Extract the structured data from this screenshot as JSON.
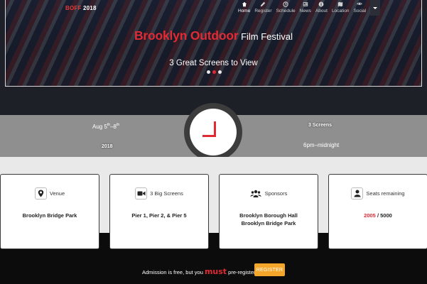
{
  "brand": {
    "part1": "BOFF",
    "part2": " 2018"
  },
  "nav": {
    "items": [
      {
        "label": "Home",
        "icon": "home-icon",
        "active": true
      },
      {
        "label": "Register",
        "icon": "pen-icon",
        "active": false
      },
      {
        "label": "Schedule",
        "icon": "clock-icon",
        "active": false
      },
      {
        "label": "News",
        "icon": "news-icon",
        "active": false
      },
      {
        "label": "About",
        "icon": "info-icon",
        "active": false
      },
      {
        "label": "Location",
        "icon": "map-icon",
        "active": false
      },
      {
        "label": "Social",
        "icon": "social-icon",
        "active": false
      }
    ]
  },
  "hero": {
    "title_red": "Brooklyn Outdoor",
    "title_white": " Film Festival",
    "subtitle": "3 Great Screens to View",
    "slides": 3,
    "active_slide": 1
  },
  "stats": {
    "dates_start": "Aug 5",
    "dates_start_sup": "th",
    "dates_mid": "–8",
    "dates_end_sup": "th",
    "year": "2018",
    "screens": "3 Screens",
    "time": "6pm–midnight"
  },
  "cards": [
    {
      "label": "Venue",
      "icon": "map-pin-icon",
      "lines": [
        "Brooklyn Bridge Park"
      ]
    },
    {
      "label": "3 Big Screens",
      "icon": "video-camera-icon",
      "lines": [
        "Pier 1, Pier 2, & Pier 5"
      ]
    },
    {
      "label": "Sponsors",
      "icon": "group-icon",
      "lines": [
        "Brooklyn Borough Hall",
        "Brooklyn Bridge Park"
      ]
    },
    {
      "label": "Seats remaining",
      "icon": "user-icon",
      "seats_taken": "2005",
      "seats_sep": " / ",
      "seats_total": "5000"
    }
  ],
  "register": {
    "text_before": "Admission is free, but you ",
    "text_must": "must",
    "text_after": " pre-register!",
    "button": "REGISTER"
  },
  "colors": {
    "accent": "#e02b35",
    "button": "#f4a62a",
    "band": "#8f8f8f"
  }
}
